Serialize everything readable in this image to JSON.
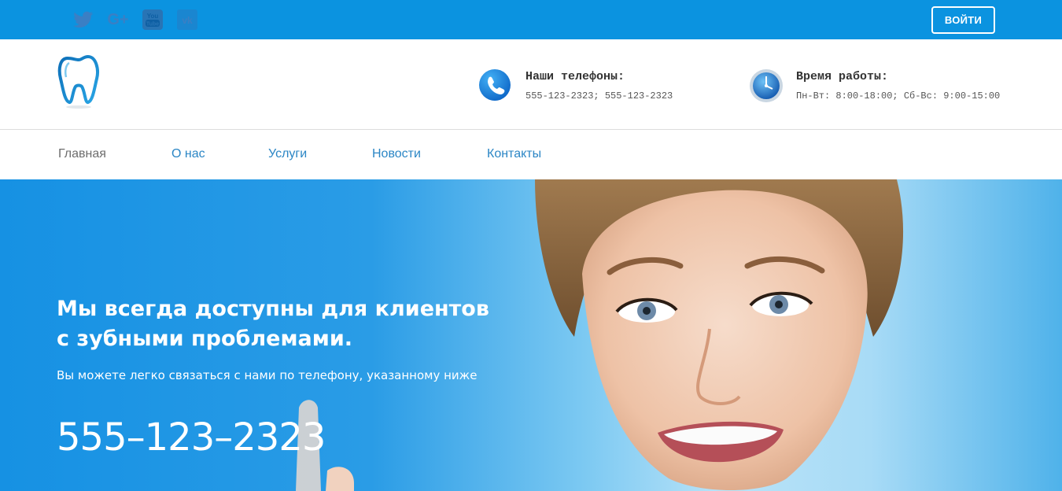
{
  "topbar": {
    "social": [
      {
        "icon": "twitter-icon"
      },
      {
        "icon": "google-plus-icon",
        "label": "G+"
      },
      {
        "icon": "youtube-icon",
        "label": "You Tube"
      },
      {
        "icon": "vk-icon",
        "label": "vk"
      }
    ],
    "login_label": "ВОЙТИ"
  },
  "header": {
    "phones": {
      "title": "Наши телефоны:",
      "value": "555-123-2323; 555-123-2323"
    },
    "hours": {
      "title": "Время работы:",
      "value": "Пн-Вт: 8:00-18:00; Сб-Вс: 9:00-15:00"
    }
  },
  "nav": {
    "items": [
      {
        "label": "Главная"
      },
      {
        "label": "О нас"
      },
      {
        "label": "Услуги"
      },
      {
        "label": "Новости"
      },
      {
        "label": "Контакты"
      }
    ]
  },
  "hero": {
    "title_line1": "Мы всегда доступны для клиентов",
    "title_line2": "с зубными проблемами.",
    "subtitle": "Вы можете легко связаться с нами по телефону, указанному ниже",
    "phone": "555–123–2323"
  },
  "colors": {
    "topbar": "#0b93e0",
    "nav_link": "#2b86c5",
    "nav_active": "#6d6d6d",
    "hero_start": "#1691e3"
  }
}
